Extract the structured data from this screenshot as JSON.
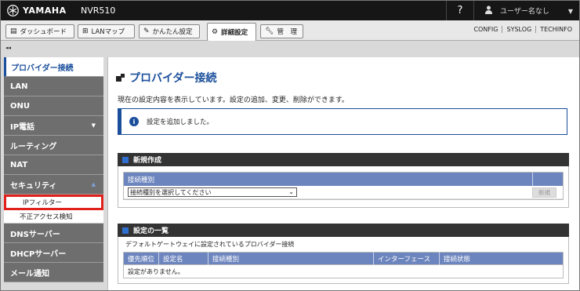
{
  "header": {
    "brand": "YAMAHA",
    "model": "NVR510",
    "help": "?",
    "user": "ユーザー名なし"
  },
  "tabs": [
    {
      "label": "ダッシュボード",
      "icon": "dashboard-icon"
    },
    {
      "label": "LANマップ",
      "icon": "lan-map-icon"
    },
    {
      "label": "かんたん設定",
      "icon": "wizard-icon"
    },
    {
      "label": "詳細設定",
      "icon": "gear-icon"
    },
    {
      "label": "管　理",
      "icon": "wrench-icon"
    }
  ],
  "links": [
    "CONFIG",
    "SYSLOG",
    "TECHINFO"
  ],
  "sidebar": {
    "collapse": "◂◂",
    "items": [
      {
        "label": "プロバイダー接続"
      },
      {
        "label": "LAN"
      },
      {
        "label": "ONU"
      },
      {
        "label": "IP電話"
      },
      {
        "label": "ルーティング"
      },
      {
        "label": "NAT"
      },
      {
        "label": "セキュリティ"
      },
      {
        "label": "IPフィルター"
      },
      {
        "label": "不正アクセス検知"
      },
      {
        "label": "DNSサーバー"
      },
      {
        "label": "DHCPサーバー"
      },
      {
        "label": "メール通知"
      }
    ]
  },
  "main": {
    "title": "プロバイダー接続",
    "description": "現在の設定内容を表示しています。設定の追加、変更、削除ができます。",
    "info_message": "設定を追加しました。",
    "new_section": {
      "title": "新規作成",
      "column": "接続種別",
      "select_value": "接続種別を選択してください",
      "new_button": "新規"
    },
    "list_section": {
      "title": "設定の一覧",
      "note": "デフォルトゲートウェイに設定されているプロバイダー接続",
      "columns": [
        "優先順位",
        "設定名",
        "接続種別",
        "インターフェース",
        "接続状態"
      ],
      "empty": "設定がありません。"
    }
  },
  "colors": {
    "accent": "#1b4f9c",
    "highlight": "#e1201c",
    "table_header": "#6d85be"
  }
}
